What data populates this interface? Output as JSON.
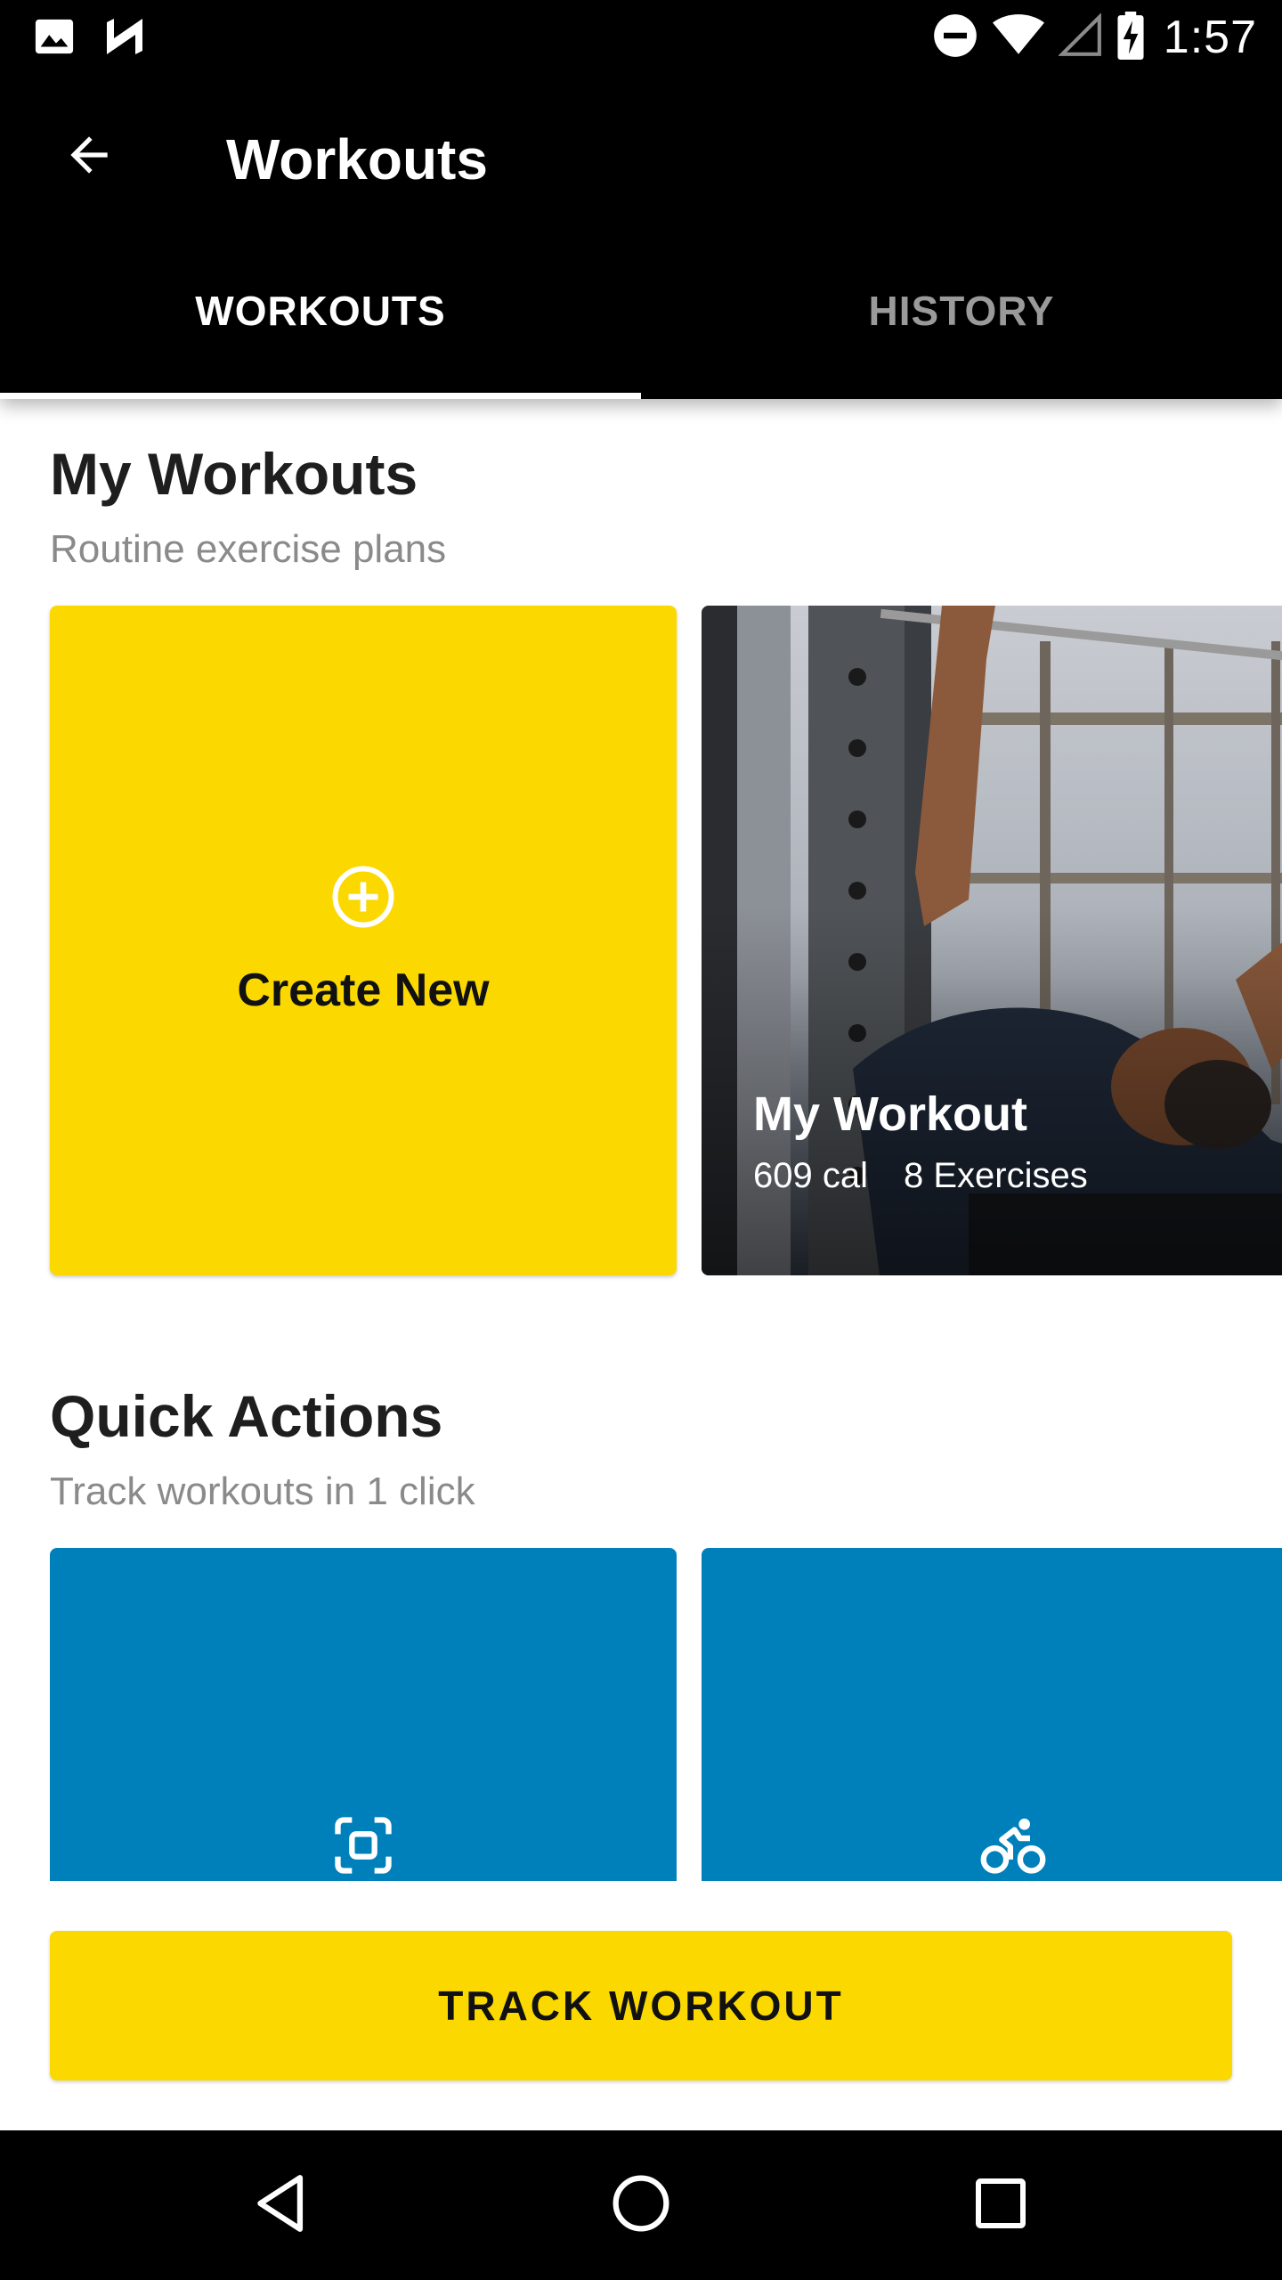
{
  "status_bar": {
    "time": "1:57",
    "left_icons": [
      "image-icon",
      "n-notification-icon"
    ],
    "right_icons": [
      "do-not-disturb-icon",
      "wifi-icon",
      "signal-icon",
      "battery-charging-icon"
    ]
  },
  "app_bar": {
    "title": "Workouts",
    "back_icon": "arrow-back-icon"
  },
  "tabs": [
    {
      "label": "WORKOUTS",
      "active": true
    },
    {
      "label": "HISTORY",
      "active": false
    }
  ],
  "my_workouts": {
    "title": "My Workouts",
    "subtitle": "Routine exercise plans",
    "create_card": {
      "icon": "add-circle-icon",
      "label": "Create New"
    },
    "workout_card": {
      "name": "My Workout",
      "calories": "609 cal",
      "exercises": "8 Exercises"
    }
  },
  "quick_actions": {
    "title": "Quick Actions",
    "subtitle": "Track workouts in 1 click",
    "items": [
      {
        "icon": "scan-frame-icon"
      },
      {
        "icon": "cycling-icon"
      }
    ]
  },
  "bottom_button": {
    "label": "TRACK WORKOUT"
  },
  "nav_bar": {
    "icons": [
      "nav-back-icon",
      "nav-home-icon",
      "nav-recents-icon"
    ]
  },
  "colors": {
    "accent_yellow": "#fbd900",
    "action_blue": "#0080bb",
    "bar_black": "#000000"
  }
}
